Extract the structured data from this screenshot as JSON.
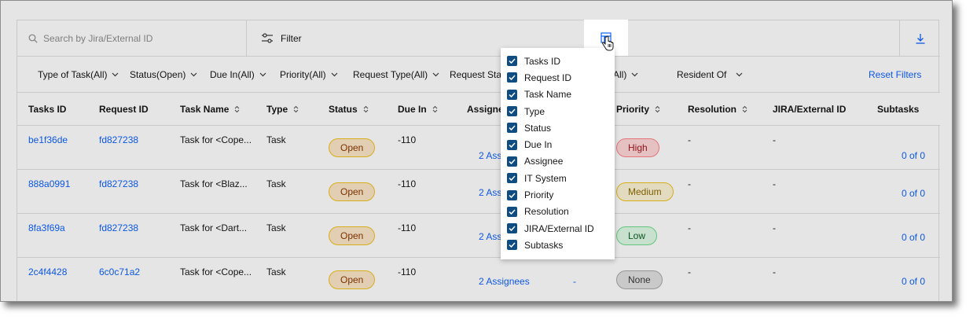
{
  "toolbar": {
    "search_placeholder": "Search by Jira/External ID",
    "filter_label": "Filter",
    "icons": {
      "search": "search-icon",
      "filter": "sliders-icon",
      "columns": "table-columns-icon",
      "download": "download-icon",
      "cursor": "hand-pointer-icon"
    }
  },
  "filters": {
    "items": [
      "Type of Task(All)",
      "Status(Open)",
      "Due In(All)",
      "Priority(All)",
      "Request Type(All)",
      "Request Statu",
      "All)",
      "Resident Of"
    ],
    "reset_label": "Reset Filters"
  },
  "table": {
    "columns": [
      {
        "label": "Tasks ID",
        "sortable": false
      },
      {
        "label": "Request ID",
        "sortable": false
      },
      {
        "label": "Task Name",
        "sortable": true
      },
      {
        "label": "Type",
        "sortable": true
      },
      {
        "label": "Status",
        "sortable": true
      },
      {
        "label": "Due In",
        "sortable": true
      },
      {
        "label": "Assignee",
        "sortable": false
      },
      {
        "label": "Priority",
        "sortable": true
      },
      {
        "label": "Resolution",
        "sortable": true
      },
      {
        "label": "JIRA/External ID",
        "sortable": false
      },
      {
        "label": "Subtasks",
        "sortable": false
      }
    ],
    "rows": [
      {
        "task_id": "be1f36de",
        "request_id": "fd827238",
        "task_name": "Task for <Cope...",
        "type": "Task",
        "status": "Open",
        "due_in": "-110",
        "assignee": "2 Assi",
        "it_system": "",
        "priority": "High",
        "resolution": "-",
        "jira": "-",
        "subtasks": "0 of 0"
      },
      {
        "task_id": "888a0991",
        "request_id": "fd827238",
        "task_name": "Task for <Blaz...",
        "type": "Task",
        "status": "Open",
        "due_in": "-110",
        "assignee": "2 Assi",
        "it_system": "",
        "priority": "Medium",
        "resolution": "-",
        "jira": "-",
        "subtasks": "0 of 0"
      },
      {
        "task_id": "8fa3f69a",
        "request_id": "fd827238",
        "task_name": "Task for <Dart...",
        "type": "Task",
        "status": "Open",
        "due_in": "-110",
        "assignee": "2 Assi",
        "it_system": "",
        "priority": "Low",
        "resolution": "-",
        "jira": "-",
        "subtasks": "0 of 0"
      },
      {
        "task_id": "2c4f4428",
        "request_id": "6c0c71a2",
        "task_name": "Task for <Cope...",
        "type": "Task",
        "status": "Open",
        "due_in": "-110",
        "assignee": "2 Assignees",
        "it_system": "-",
        "priority": "None",
        "resolution": "-",
        "jira": "-",
        "subtasks": "0 of 0"
      }
    ]
  },
  "column_menu": {
    "options": [
      {
        "label": "Tasks ID",
        "checked": true
      },
      {
        "label": "Request ID",
        "checked": true
      },
      {
        "label": "Task Name",
        "checked": true
      },
      {
        "label": "Type",
        "checked": true
      },
      {
        "label": "Status",
        "checked": true
      },
      {
        "label": "Due In",
        "checked": true
      },
      {
        "label": "Assignee",
        "checked": true
      },
      {
        "label": "IT System",
        "checked": true
      },
      {
        "label": "Priority",
        "checked": true
      },
      {
        "label": "Resolution",
        "checked": true
      },
      {
        "label": "JIRA/External ID",
        "checked": true
      },
      {
        "label": "Subtasks",
        "checked": true
      }
    ]
  },
  "colors": {
    "link": "#0f62fe",
    "checkbox": "#0f4c81",
    "status_open": "#fce6c8",
    "priority_high": "#ffd7d9",
    "priority_medium": "#fcf4d6",
    "priority_low": "#defbe6",
    "priority_none": "#e0e0e0"
  }
}
